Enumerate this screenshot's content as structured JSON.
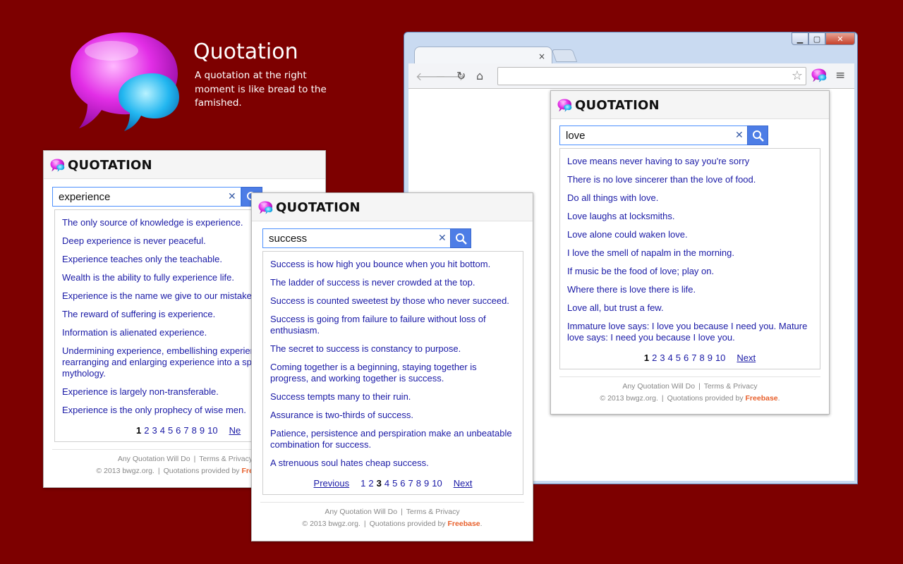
{
  "hero": {
    "title": "Quotation",
    "tagline": "A quotation at the right moment is like bread to the famished."
  },
  "browser": {
    "tab_close": "×",
    "menu": "≡"
  },
  "app": {
    "title": "QUOTATION",
    "footer_line1": "Any Quotation Will Do",
    "terms": "Terms & Privacy",
    "copyright": "© 2013 bwgz.org.",
    "provided": "Quotations provided by",
    "freebase": "Freebase",
    "period": "."
  },
  "popups": [
    {
      "query": "experience",
      "quotes": [
        "The only source of knowledge is experience.",
        "Deep experience is never peaceful.",
        "Experience teaches only the teachable.",
        "Wealth is the ability to fully experience life.",
        "Experience is the name we give to our mistake",
        "The reward of suffering is experience.",
        "Information is alienated experience.",
        "Undermining experience, embellishing experien rearranging and enlarging experience into a sp mythology.",
        "Experience is largely non-transferable.",
        "Experience is the only prophecy of wise men."
      ],
      "pages": [
        "1",
        "2",
        "3",
        "4",
        "5",
        "6",
        "7",
        "8",
        "9",
        "10"
      ],
      "current_page": "1",
      "next": "Ne"
    },
    {
      "query": "success",
      "quotes": [
        "Success is how high you bounce when you hit bottom.",
        "The ladder of success is never crowded at the top.",
        "Success is counted sweetest by those who never succeed.",
        "Success is going from failure to failure without loss of enthusiasm.",
        "The secret to success is constancy to purpose.",
        "Coming together is a beginning, staying together is progress, and working together is success.",
        "Success tempts many to their ruin.",
        "Assurance is two-thirds of success.",
        "Patience, persistence and perspiration make an unbeatable combination for success.",
        "A strenuous soul hates cheap success."
      ],
      "previous": "Previous",
      "pages": [
        "1",
        "2",
        "3",
        "4",
        "5",
        "6",
        "7",
        "8",
        "9",
        "10"
      ],
      "current_page": "3",
      "next": "Next"
    },
    {
      "query": "love",
      "quotes": [
        "Love means never having to say you're sorry",
        "There is no love sincerer than the love of food.",
        "Do all things with love.",
        "Love laughs at locksmiths.",
        "Love alone could waken love.",
        "I love the smell of napalm in the morning.",
        "If music be the food of love; play on.",
        "Where there is love there is life.",
        "Love all, but trust a few.",
        "Immature love says: I love you because I need you. Mature love says: I need you because I love you."
      ],
      "pages": [
        "1",
        "2",
        "3",
        "4",
        "5",
        "6",
        "7",
        "8",
        "9",
        "10"
      ],
      "current_page": "1",
      "next": "Next"
    }
  ]
}
